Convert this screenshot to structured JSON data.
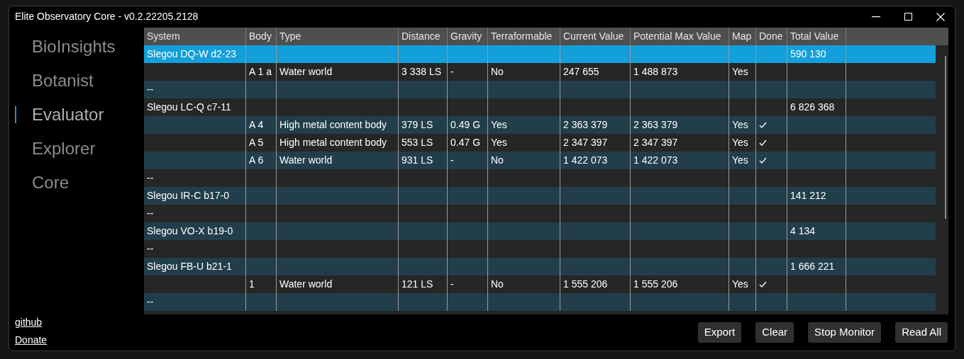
{
  "window": {
    "title": "Elite Observatory Core - v0.2.22205.2128"
  },
  "nav": [
    {
      "label": "BioInsights",
      "selected": false
    },
    {
      "label": "Botanist",
      "selected": false
    },
    {
      "label": "Evaluator",
      "selected": true
    },
    {
      "label": "Explorer",
      "selected": false
    },
    {
      "label": "Core",
      "selected": false
    }
  ],
  "links": [
    "github",
    "Donate"
  ],
  "table": {
    "columns": [
      "System",
      "Body",
      "Type",
      "Distance",
      "Gravity",
      "Terraformable",
      "Current Value",
      "Potential Max Value",
      "Map",
      "Done",
      "Total Value"
    ],
    "rows": [
      {
        "selected": true,
        "cells": [
          "Slegou DQ-W d2-23",
          "",
          "",
          "",
          "",
          "",
          "",
          "",
          "",
          "",
          "590 130"
        ]
      },
      {
        "selected": false,
        "done": false,
        "cells": [
          "",
          "A 1 a",
          "Water world",
          "3 338 LS",
          "-",
          "No",
          "247 655",
          "1 488 873",
          "Yes",
          "",
          ""
        ]
      },
      {
        "selected": false,
        "cells": [
          "--",
          "",
          "",
          "",
          "",
          "",
          "",
          "",
          "",
          "",
          ""
        ]
      },
      {
        "selected": false,
        "cells": [
          "Slegou LC-Q c7-11",
          "",
          "",
          "",
          "",
          "",
          "",
          "",
          "",
          "",
          "6 826 368"
        ]
      },
      {
        "selected": false,
        "done": true,
        "cells": [
          "",
          "A 4",
          "High metal content body",
          "379 LS",
          "0.49 G",
          "Yes",
          "2 363 379",
          "2 363 379",
          "Yes",
          "",
          ""
        ]
      },
      {
        "selected": false,
        "done": true,
        "cells": [
          "",
          "A 5",
          "High metal content body",
          "553 LS",
          "0.47 G",
          "Yes",
          "2 347 397",
          "2 347 397",
          "Yes",
          "",
          ""
        ]
      },
      {
        "selected": false,
        "done": true,
        "cells": [
          "",
          "A 6",
          "Water world",
          "931 LS",
          "-",
          "No",
          "1 422 073",
          "1 422 073",
          "Yes",
          "",
          ""
        ]
      },
      {
        "selected": false,
        "cells": [
          "--",
          "",
          "",
          "",
          "",
          "",
          "",
          "",
          "",
          "",
          ""
        ]
      },
      {
        "selected": false,
        "cells": [
          "Slegou IR-C b17-0",
          "",
          "",
          "",
          "",
          "",
          "",
          "",
          "",
          "",
          "141 212"
        ]
      },
      {
        "selected": false,
        "cells": [
          "--",
          "",
          "",
          "",
          "",
          "",
          "",
          "",
          "",
          "",
          ""
        ]
      },
      {
        "selected": false,
        "cells": [
          "Slegou VO-X b19-0",
          "",
          "",
          "",
          "",
          "",
          "",
          "",
          "",
          "",
          "4 134"
        ]
      },
      {
        "selected": false,
        "cells": [
          "--",
          "",
          "",
          "",
          "",
          "",
          "",
          "",
          "",
          "",
          ""
        ]
      },
      {
        "selected": false,
        "cells": [
          "Slegou FB-U b21-1",
          "",
          "",
          "",
          "",
          "",
          "",
          "",
          "",
          "",
          "1 666 221"
        ]
      },
      {
        "selected": false,
        "done": true,
        "cells": [
          "",
          "1",
          "Water world",
          "121 LS",
          "-",
          "No",
          "1 555 206",
          "1 555 206",
          "Yes",
          "",
          ""
        ]
      },
      {
        "selected": false,
        "cells": [
          "--",
          "",
          "",
          "",
          "",
          "",
          "",
          "",
          "",
          "",
          ""
        ]
      }
    ]
  },
  "buttons": [
    "Export",
    "Clear",
    "Stop Monitor",
    "Read All"
  ]
}
